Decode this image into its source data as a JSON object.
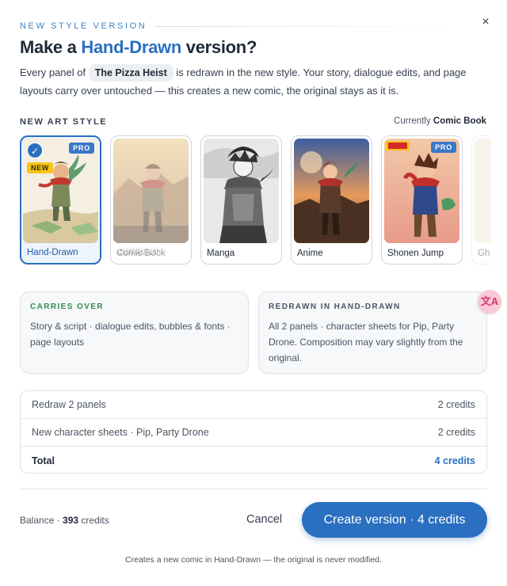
{
  "dialog": {
    "eyebrow": "NEW STYLE VERSION",
    "title_prefix": "Make a",
    "title_accent": "Hand-Drawn",
    "title_suffix": "version?",
    "desc_before": "Every panel of",
    "desc_chip": "The Pizza Heist",
    "desc_after": "is redrawn in the new style. Your story, dialogue edits, and page layouts carry over untouched — this creates a new comic, the original stays as it is.",
    "close_icon": "×"
  },
  "art_style": {
    "section_label": "NEW ART STYLE",
    "current_prefix": "Currently",
    "current_value": "Comic Book",
    "styles": [
      {
        "label": "Hand-Drawn",
        "selected": true,
        "pro": "PRO",
        "new": "NEW"
      },
      {
        "label": "Comic Book",
        "current": "CURRENT"
      },
      {
        "label": "Manga"
      },
      {
        "label": "Anime"
      },
      {
        "label": "Shonen Jump",
        "pro": "PRO"
      },
      {
        "label": "Gh"
      }
    ]
  },
  "carries_over": {
    "head": "CARRIES OVER",
    "body": "Story & script · dialogue edits, bubbles & fonts · page layouts"
  },
  "redrawn": {
    "head": "REDRAWN IN HAND-DRAWN",
    "body": "All 2 panels · character sheets for Pip, Party Drone. Composition may vary slightly from the original."
  },
  "cost": {
    "rows": [
      {
        "label": "Redraw 2 panels",
        "value": "2 credits"
      },
      {
        "label": "New character sheets · Pip, Party Drone",
        "value": "2 credits"
      }
    ],
    "total_label": "Total",
    "total_value": "4 credits"
  },
  "footer": {
    "balance_prefix": "Balance ·",
    "balance_value": "393",
    "balance_suffix": "credits",
    "cancel": "Cancel",
    "primary": "Create version · 4 credits",
    "note": "Creates a new comic in Hand-Drawn — the original is never modified."
  },
  "translate_fab": "文A",
  "colors": {
    "accent": "#2a6fc0",
    "carries_head": "#2f8a4a",
    "pro_badge": "#3a78c8",
    "new_badge": "#f5c518"
  }
}
